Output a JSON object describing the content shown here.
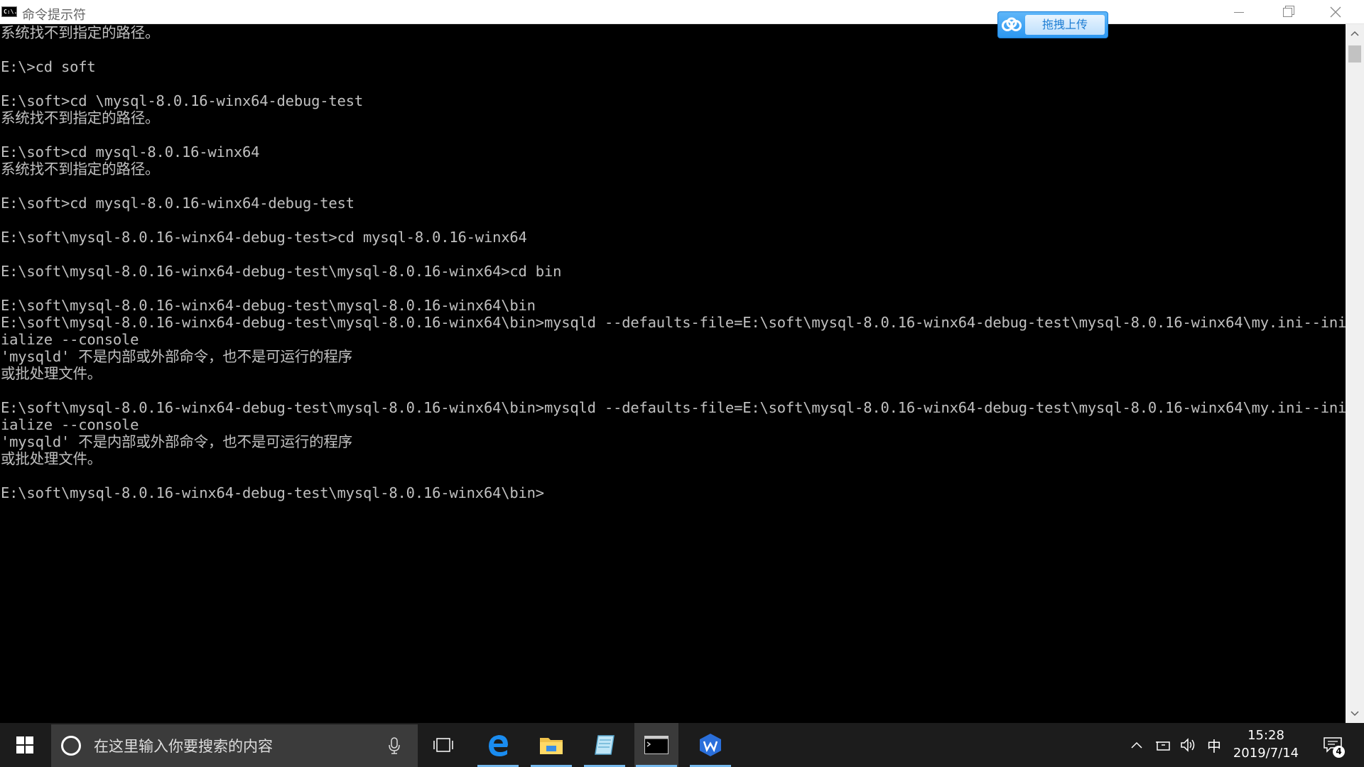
{
  "window": {
    "title": "命令提示符",
    "icon_text": "C:\\."
  },
  "upload_widget": {
    "label": "拖拽上传"
  },
  "console": {
    "lines": [
      "系统找不到指定的路径。",
      "",
      "E:\\>cd soft",
      "",
      "E:\\soft>cd \\mysql-8.0.16-winx64-debug-test",
      "系统找不到指定的路径。",
      "",
      "E:\\soft>cd mysql-8.0.16-winx64",
      "系统找不到指定的路径。",
      "",
      "E:\\soft>cd mysql-8.0.16-winx64-debug-test",
      "",
      "E:\\soft\\mysql-8.0.16-winx64-debug-test>cd mysql-8.0.16-winx64",
      "",
      "E:\\soft\\mysql-8.0.16-winx64-debug-test\\mysql-8.0.16-winx64>cd bin",
      "",
      "E:\\soft\\mysql-8.0.16-winx64-debug-test\\mysql-8.0.16-winx64\\bin",
      "E:\\soft\\mysql-8.0.16-winx64-debug-test\\mysql-8.0.16-winx64\\bin>mysqld --defaults-file=E:\\soft\\mysql-8.0.16-winx64-debug-test\\mysql-8.0.16-winx64\\my.ini--init",
      "ialize --console",
      "'mysqld' 不是内部或外部命令，也不是可运行的程序",
      "或批处理文件。",
      "",
      "E:\\soft\\mysql-8.0.16-winx64-debug-test\\mysql-8.0.16-winx64\\bin>mysqld --defaults-file=E:\\soft\\mysql-8.0.16-winx64-debug-test\\mysql-8.0.16-winx64\\my.ini--init",
      "ialize --console",
      "'mysqld' 不是内部或外部命令，也不是可运行的程序",
      "或批处理文件。",
      "",
      "E:\\soft\\mysql-8.0.16-winx64-debug-test\\mysql-8.0.16-winx64\\bin>"
    ]
  },
  "taskbar": {
    "search_placeholder": "在这里输入你要搜索的内容",
    "apps": [
      "edge-icon",
      "file-explorer-icon",
      "notepad-icon",
      "cmd-icon",
      "wps-icon"
    ],
    "ime": "中",
    "time": "15:28",
    "date": "2019/7/14",
    "notification_count": "4"
  }
}
